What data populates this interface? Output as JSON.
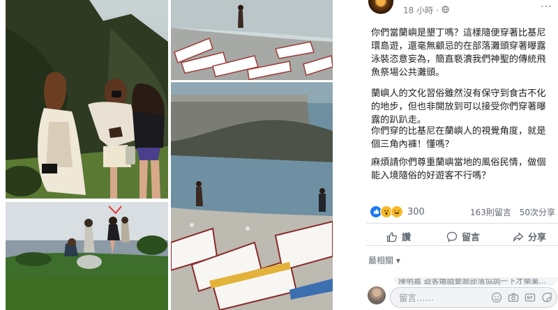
{
  "post": {
    "author": "·· ···",
    "time": "18 小時",
    "privacy_icon": "globe-icon",
    "more_label": "···",
    "paragraphs": [
      "你們當蘭嶼是墾丁嗎？這樣隨便穿著比基尼環島遊，還毫無顧忌的在部落灘頭穿著曝露泳裝恣意妄為，簡直褻瀆我們神聖的傳統飛魚祭場公共灘頭。",
      "蘭嶼人的文化習俗雖然沒有保守到食古不化的地步，但也非開放到可以接受你們穿著曝露的趴趴走。",
      "你們穿的比基尼在蘭嶼人的視覺角度，就是個三角內褲！懂嗎？",
      "麻煩請你們尊重蘭嶼當地的風俗民情，做個能入境隨俗的好遊客不行嗎？"
    ]
  },
  "reactions": {
    "icons": [
      "like-icon",
      "wow-icon",
      "haha-icon"
    ],
    "count": "300",
    "comments": "163則留言",
    "shares": "50次分享"
  },
  "actions": {
    "like": "讚",
    "comment": "留言",
    "share": "分享"
  },
  "comments": {
    "sort_label": "最相關",
    "partial_comment": "陳明嘉  遊客嬉戲要跟部落協調一下才樂業..."
  },
  "composer": {
    "placeholder": "留言……"
  },
  "colors": {
    "accent": "#385898",
    "like_blue": "#1877f2",
    "wow_yellow": "#f7b928",
    "divider": "#dadde1"
  }
}
